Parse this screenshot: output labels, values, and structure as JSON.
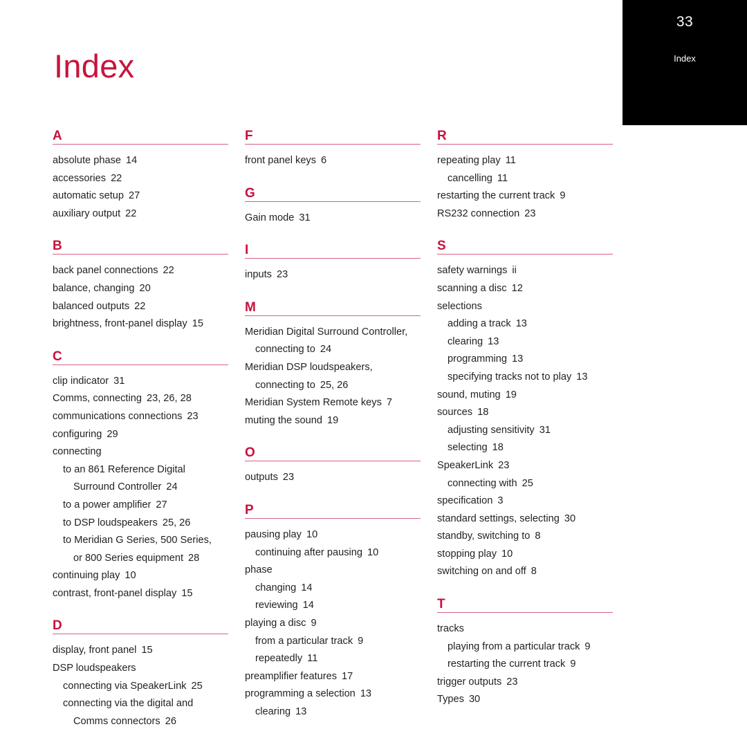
{
  "page": {
    "title": "Index",
    "folio": "33",
    "tab_label": "Index",
    "accent_color": "#c8103e",
    "rule_color": "#d9607f",
    "title_color": "#c8143c",
    "tab_background": "#000000",
    "text_color": "#231f20"
  },
  "columns": [
    {
      "letters": [
        {
          "letter": "A",
          "entries": [
            {
              "level": 0,
              "text": "absolute phase",
              "pages": "14"
            },
            {
              "level": 0,
              "text": "accessories",
              "pages": "22"
            },
            {
              "level": 0,
              "text": "automatic setup",
              "pages": "27"
            },
            {
              "level": 0,
              "text": "auxiliary output",
              "pages": "22"
            }
          ]
        },
        {
          "letter": "B",
          "entries": [
            {
              "level": 0,
              "text": "back panel connections",
              "pages": "22"
            },
            {
              "level": 0,
              "text": "balance, changing",
              "pages": "20"
            },
            {
              "level": 0,
              "text": "balanced outputs",
              "pages": "22"
            },
            {
              "level": 0,
              "text": "brightness, front-panel display",
              "pages": "15"
            }
          ]
        },
        {
          "letter": "C",
          "entries": [
            {
              "level": 0,
              "text": "clip indicator",
              "pages": "31"
            },
            {
              "level": 0,
              "text": "Comms, connecting",
              "pages": "23, 26, 28"
            },
            {
              "level": 0,
              "text": "communications connections",
              "pages": "23"
            },
            {
              "level": 0,
              "text": "configuring",
              "pages": "29"
            },
            {
              "level": 0,
              "text": "connecting",
              "pages": ""
            },
            {
              "level": 1,
              "text": "to an 861 Reference Digital",
              "pages": ""
            },
            {
              "level": 2,
              "text": "Surround Controller",
              "pages": "24"
            },
            {
              "level": 1,
              "text": "to a power amplifier",
              "pages": "27"
            },
            {
              "level": 1,
              "text": "to DSP loudspeakers",
              "pages": "25, 26"
            },
            {
              "level": 1,
              "text": "to Meridian G Series, 500 Series,",
              "pages": ""
            },
            {
              "level": 2,
              "text": "or 800 Series equipment",
              "pages": "28"
            },
            {
              "level": 0,
              "text": "continuing play",
              "pages": "10"
            },
            {
              "level": 0,
              "text": "contrast, front-panel display",
              "pages": "15"
            }
          ]
        },
        {
          "letter": "D",
          "entries": [
            {
              "level": 0,
              "text": "display, front panel",
              "pages": "15"
            },
            {
              "level": 0,
              "text": "DSP loudspeakers",
              "pages": ""
            },
            {
              "level": 1,
              "text": "connecting via SpeakerLink",
              "pages": "25"
            },
            {
              "level": 1,
              "text": "connecting via the digital and",
              "pages": ""
            },
            {
              "level": 2,
              "text": "Comms connectors",
              "pages": "26"
            }
          ]
        }
      ]
    },
    {
      "letters": [
        {
          "letter": "F",
          "entries": [
            {
              "level": 0,
              "text": "front panel keys",
              "pages": "6"
            }
          ]
        },
        {
          "letter": "G",
          "entries": [
            {
              "level": 0,
              "text": "Gain mode",
              "pages": "31"
            }
          ]
        },
        {
          "letter": "I",
          "entries": [
            {
              "level": 0,
              "text": "inputs",
              "pages": "23"
            }
          ]
        },
        {
          "letter": "M",
          "entries": [
            {
              "level": 0,
              "text": "Meridian Digital Surround Controller,",
              "pages": ""
            },
            {
              "level": 1,
              "text": "connecting to",
              "pages": "24"
            },
            {
              "level": 0,
              "text": "Meridian DSP loudspeakers,",
              "pages": ""
            },
            {
              "level": 1,
              "text": "connecting to",
              "pages": "25, 26"
            },
            {
              "level": 0,
              "text": "Meridian System Remote keys",
              "pages": "7"
            },
            {
              "level": 0,
              "text": "muting the sound",
              "pages": "19"
            }
          ]
        },
        {
          "letter": "O",
          "entries": [
            {
              "level": 0,
              "text": "outputs",
              "pages": "23"
            }
          ]
        },
        {
          "letter": "P",
          "entries": [
            {
              "level": 0,
              "text": "pausing play",
              "pages": "10"
            },
            {
              "level": 1,
              "text": "continuing after pausing",
              "pages": "10"
            },
            {
              "level": 0,
              "text": "phase",
              "pages": ""
            },
            {
              "level": 1,
              "text": "changing",
              "pages": "14"
            },
            {
              "level": 1,
              "text": "reviewing",
              "pages": "14"
            },
            {
              "level": 0,
              "text": "playing a disc",
              "pages": "9"
            },
            {
              "level": 1,
              "text": "from a particular track",
              "pages": "9"
            },
            {
              "level": 1,
              "text": "repeatedly",
              "pages": "11"
            },
            {
              "level": 0,
              "text": "preamplifier features",
              "pages": "17"
            },
            {
              "level": 0,
              "text": "programming a selection",
              "pages": "13"
            },
            {
              "level": 1,
              "text": "clearing",
              "pages": "13"
            }
          ]
        }
      ]
    },
    {
      "letters": [
        {
          "letter": "R",
          "entries": [
            {
              "level": 0,
              "text": "repeating play",
              "pages": "11"
            },
            {
              "level": 1,
              "text": "cancelling",
              "pages": "11"
            },
            {
              "level": 0,
              "text": "restarting the current track",
              "pages": "9"
            },
            {
              "level": 0,
              "text": "RS232 connection",
              "pages": "23"
            }
          ]
        },
        {
          "letter": "S",
          "entries": [
            {
              "level": 0,
              "text": "safety warnings",
              "pages": "ii"
            },
            {
              "level": 0,
              "text": "scanning a disc",
              "pages": "12"
            },
            {
              "level": 0,
              "text": "selections",
              "pages": ""
            },
            {
              "level": 1,
              "text": "adding a track",
              "pages": "13"
            },
            {
              "level": 1,
              "text": "clearing",
              "pages": "13"
            },
            {
              "level": 1,
              "text": "programming",
              "pages": "13"
            },
            {
              "level": 1,
              "text": "specifying tracks not to play",
              "pages": "13"
            },
            {
              "level": 0,
              "text": "sound, muting",
              "pages": "19"
            },
            {
              "level": 0,
              "text": "sources",
              "pages": "18"
            },
            {
              "level": 1,
              "text": "adjusting sensitivity",
              "pages": "31"
            },
            {
              "level": 1,
              "text": "selecting",
              "pages": "18"
            },
            {
              "level": 0,
              "text": "SpeakerLink",
              "pages": "23"
            },
            {
              "level": 1,
              "text": "connecting with",
              "pages": "25"
            },
            {
              "level": 0,
              "text": "specification",
              "pages": "3"
            },
            {
              "level": 0,
              "text": "standard settings, selecting",
              "pages": "30"
            },
            {
              "level": 0,
              "text": "standby, switching to",
              "pages": "8"
            },
            {
              "level": 0,
              "text": "stopping play",
              "pages": "10"
            },
            {
              "level": 0,
              "text": "switching on and off",
              "pages": "8"
            }
          ]
        },
        {
          "letter": "T",
          "entries": [
            {
              "level": 0,
              "text": "tracks",
              "pages": ""
            },
            {
              "level": 1,
              "text": "playing from a particular track",
              "pages": "9"
            },
            {
              "level": 1,
              "text": "restarting the current track",
              "pages": "9"
            },
            {
              "level": 0,
              "text": "trigger outputs",
              "pages": "23"
            },
            {
              "level": 0,
              "text": "Types",
              "pages": "30"
            }
          ]
        }
      ]
    }
  ]
}
